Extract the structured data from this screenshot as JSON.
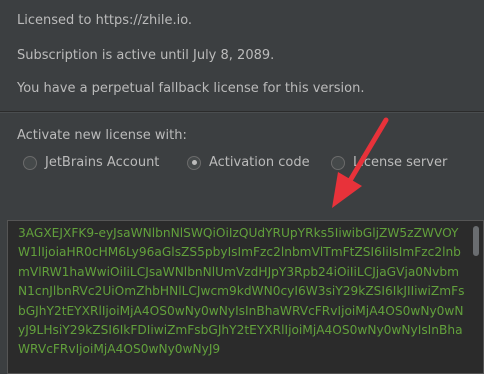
{
  "license": {
    "licensed_to": "Licensed to https://zhile.io.",
    "subscription": "Subscription is active until July 8, 2089.",
    "fallback": "You have a perpetual fallback license for this version."
  },
  "activate": {
    "label": "Activate new license with:",
    "options": [
      {
        "label": "JetBrains Account",
        "selected": false
      },
      {
        "label": "Activation code",
        "selected": true
      },
      {
        "label": "License server",
        "selected": false
      }
    ]
  },
  "activation_code": "3AGXEJXFK9-eyJsaWNlbnNlSWQiOiIzQUdYRUpYRks5IiwibGljZW5zZWVOYW1lIjoiaHR0cHM6Ly96aGlsZS5pbyIsImFzc2lnbmVlTmFtZSI6IiIsImFzc2lnbmVlRW1haWwiOiIiLCJsaWNlbnNlUmVzdHJpY3Rpb24iOiIiLCJjaGVja0NvbmN1cnJlbnRVc2UiOmZhbHNlLCJwcm9kdWN0cyI6W3siY29kZSI6IkJIIiwiZmFsbGJhY2tEYXRlIjoiMjA4OS0wNy0wNyIsInBhaWRVcFRvIjoiMjA4OS0wNy0wNyJ9LHsiY29kZSI6IkFDIiwiZmFsbGJhY2tEYXRlIjoiMjA4OS0wNy0wNyIsInBhaWRVcFRvIjoiMjA4OS0wNy0wNyJ9",
  "colors": {
    "background": "#3c3f41",
    "code_text": "#62a03c",
    "arrow": "#e8323a"
  }
}
